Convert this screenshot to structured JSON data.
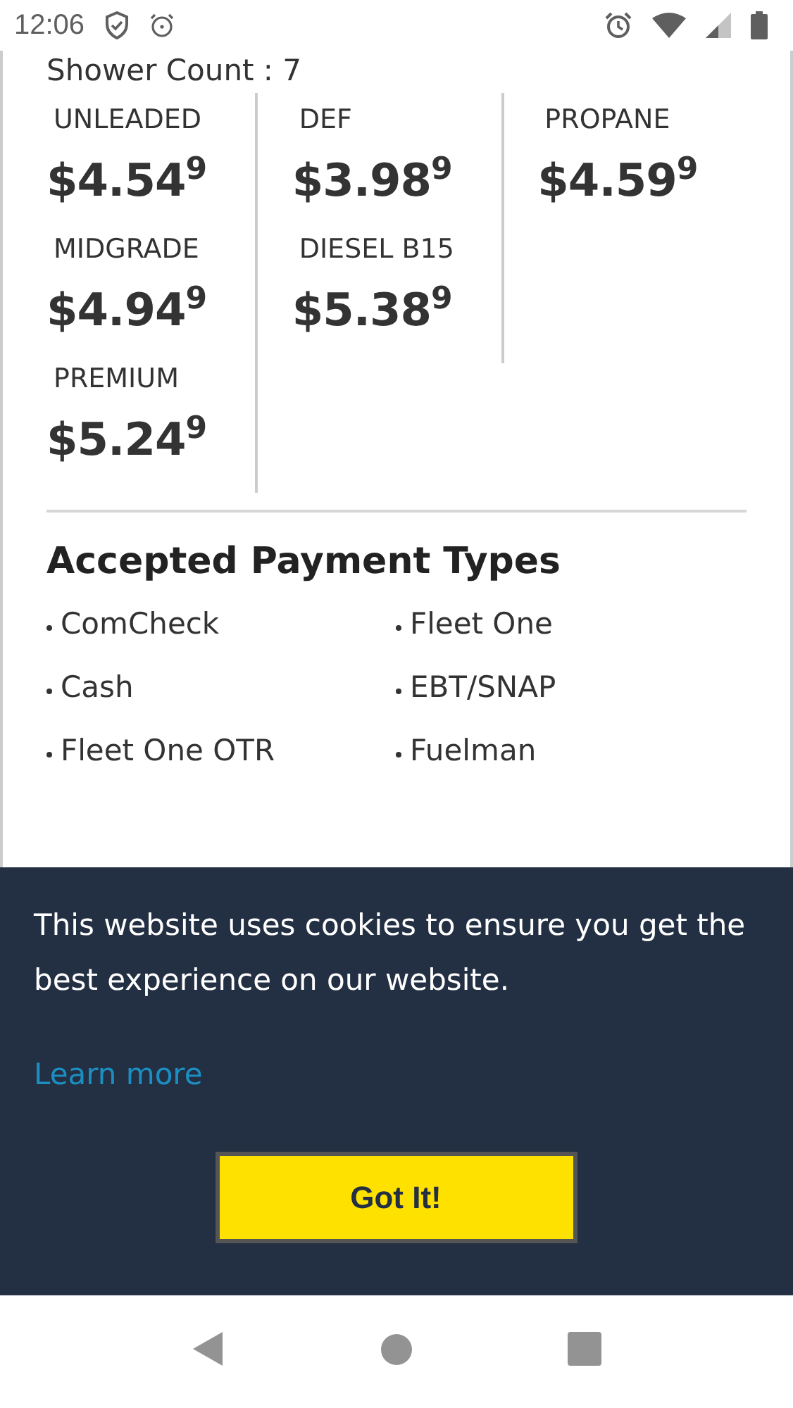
{
  "status_bar": {
    "time": "12:06"
  },
  "shower_count": "Shower Count : 7",
  "fuel_columns": [
    [
      {
        "label": "UNLEADED",
        "price": "$4.54$^{9}$"
      },
      {
        "label": "MIDGRADE",
        "price": "$4.94$^{9}$"
      },
      {
        "label": "PREMIUM",
        "price": "$5.24$^{9}$"
      }
    ],
    [
      {
        "label": "DEF",
        "price": "$3.98$^{9}$"
      },
      {
        "label": "DIESEL B15",
        "price": "$5.38$^{9}$"
      }
    ],
    [
      {
        "label": "PROPANE",
        "price": "$4.59$^{9}$"
      }
    ]
  ],
  "payment": {
    "title": "Accepted Payment Types",
    "items": [
      "ComCheck",
      "Fleet One",
      "Cash",
      "EBT/SNAP",
      "Fleet One OTR",
      "Fuelman"
    ]
  },
  "cookie_banner": {
    "message": "This website uses cookies to ensure you get the best experience on our website.",
    "link": "Learn more",
    "button": "Got It!"
  }
}
